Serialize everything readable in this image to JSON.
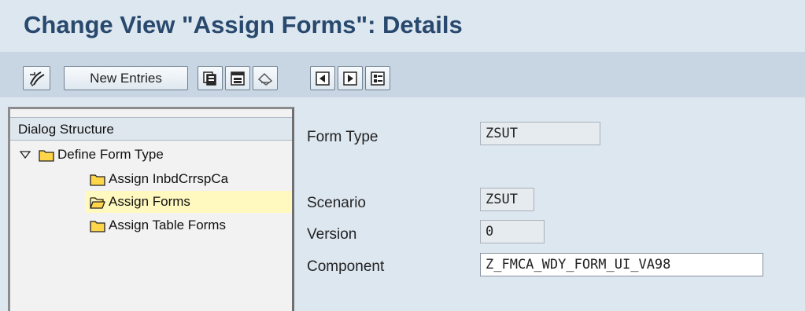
{
  "window": {
    "title": "Change View \"Assign Forms\": Details"
  },
  "toolbar": {
    "buttons": [
      {
        "icon": "display-change-icon"
      },
      {
        "label": "New Entries"
      },
      {
        "icon": "copy-as-icon"
      },
      {
        "icon": "delete-icon"
      },
      {
        "icon": "undo-change-icon"
      },
      {
        "icon": "previous-entry-icon"
      },
      {
        "icon": "next-entry-icon"
      },
      {
        "icon": "select-all-icon"
      }
    ]
  },
  "dialog_structure": {
    "header": "Dialog Structure",
    "items": [
      {
        "label": "Define Form Type",
        "level": 0,
        "expanded": true,
        "selected": false
      },
      {
        "label": "Assign InbdCrrspCa",
        "level": 1,
        "selected": false
      },
      {
        "label": "Assign Forms",
        "level": 1,
        "selected": true
      },
      {
        "label": "Assign Table Forms",
        "level": 1,
        "selected": false
      }
    ]
  },
  "details": {
    "form_type": {
      "label": "Form Type",
      "value": "ZSUT",
      "editable": false
    },
    "scenario": {
      "label": "Scenario",
      "value": "ZSUT",
      "editable": false
    },
    "version": {
      "label": "Version",
      "value": "0",
      "editable": false
    },
    "component": {
      "label": "Component",
      "value": "Z_FMCA_WDY_FORM_UI_VA98",
      "editable": true
    }
  },
  "colors": {
    "title": "#28496d",
    "background": "#dde7f0",
    "selected_row": "#fff9bf"
  }
}
